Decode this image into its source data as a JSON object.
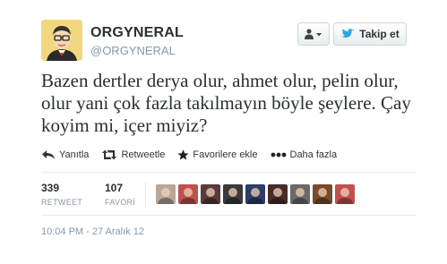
{
  "author": {
    "display_name": "ORGYNERAL",
    "handle": "@ORGYNERAL"
  },
  "header_buttons": {
    "user_menu_icon": "user-dropdown-icon",
    "follow_label": "Takip et",
    "follow_icon": "twitter-bird-icon"
  },
  "tweet": {
    "text": "Bazen dertler derya olur, ahmet olur, pelin olur, olur yani çok fazla takılmayın böyle şeylere. Çay koyim mi, içer miyiz?"
  },
  "actions": {
    "reply": "Yanıtla",
    "retweet": "Retweetle",
    "favorite": "Favorilere ekle",
    "more": "Daha fazla"
  },
  "stats": {
    "retweets_count": "339",
    "retweets_label": "RETWEET",
    "favorites_count": "107",
    "favorites_label": "FAVORİ"
  },
  "faces": [
    {
      "icon": "user-avatar",
      "color": "#b8a89a"
    },
    {
      "icon": "user-avatar",
      "color": "#c0504d"
    },
    {
      "icon": "user-avatar",
      "color": "#5a3a3a"
    },
    {
      "icon": "user-avatar",
      "color": "#3a3a3a"
    },
    {
      "icon": "user-avatar",
      "color": "#2c3e66"
    },
    {
      "icon": "user-avatar",
      "color": "#4a2a2a"
    },
    {
      "icon": "user-avatar",
      "color": "#6a6a6a"
    },
    {
      "icon": "user-avatar",
      "color": "#7a4a2a"
    },
    {
      "icon": "user-avatar",
      "color": "#c05050"
    }
  ],
  "timestamp": "10:04 PM - 27 Aralık 12",
  "colors": {
    "twitter_blue": "#2ba7e1",
    "name_text": "#292f33",
    "meta_text": "#8899a6"
  }
}
